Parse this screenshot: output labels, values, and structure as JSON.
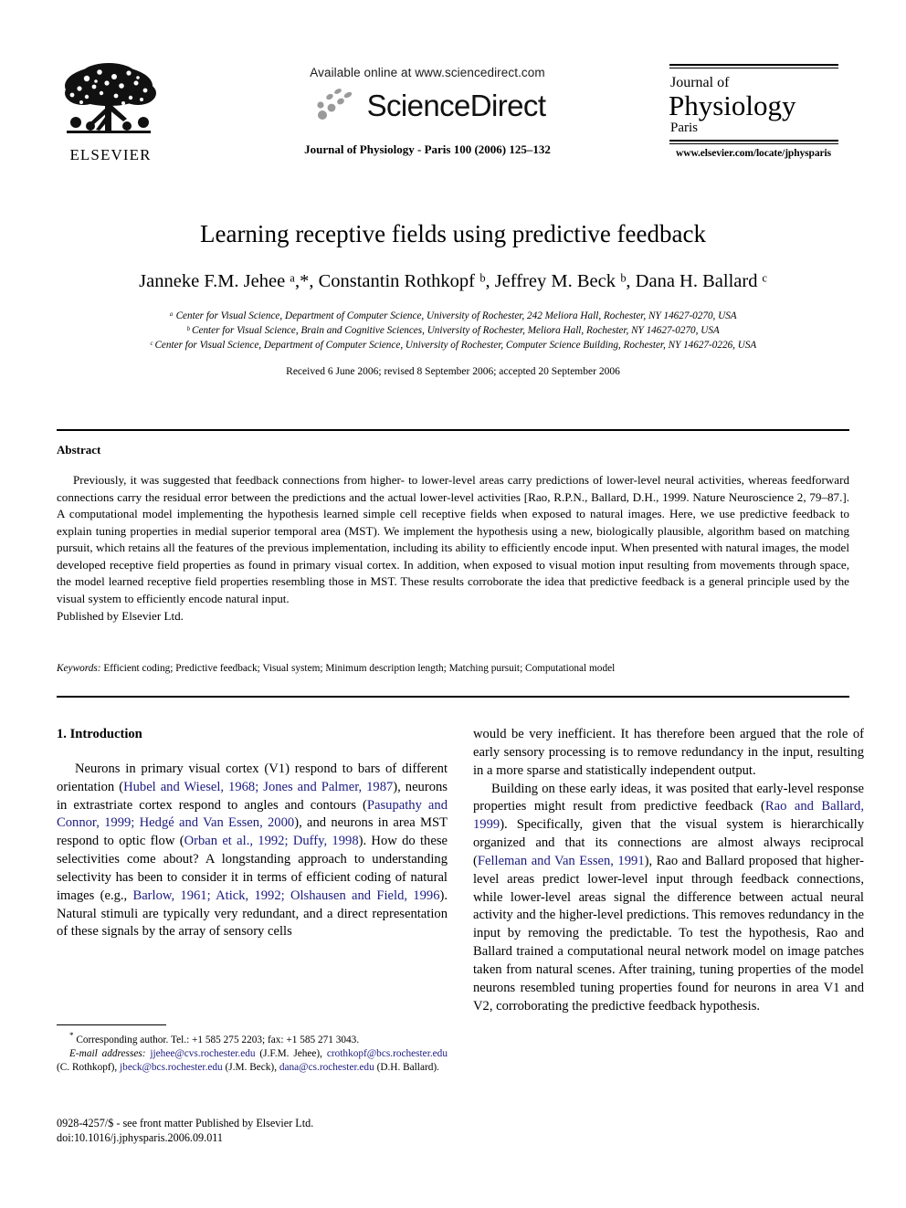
{
  "masthead": {
    "elsevier_wordmark": "ELSEVIER",
    "available_online": "Available online at www.sciencedirect.com",
    "sciencedirect_wordmark": "ScienceDirect",
    "journal_citation": "Journal of Physiology - Paris 100 (2006) 125–132",
    "journal_line1": "Journal of",
    "journal_line2": "Physiology",
    "journal_line3": "Paris",
    "journal_url": "www.elsevier.com/locate/jphysparis"
  },
  "title": "Learning receptive fields using predictive feedback",
  "authors": "Janneke F.M. Jehee ᵃ,*, Constantin Rothkopf ᵇ, Jeffrey M. Beck ᵇ, Dana H. Ballard ᶜ",
  "affiliations": [
    "ᵃ Center for Visual Science, Department of Computer Science, University of Rochester, 242 Meliora Hall, Rochester, NY 14627-0270, USA",
    "ᵇ Center for Visual Science, Brain and Cognitive Sciences, University of Rochester, Meliora Hall, Rochester, NY 14627-0270, USA",
    "ᶜ Center for Visual Science, Department of Computer Science, University of Rochester, Computer Science Building, Rochester, NY 14627-0226, USA"
  ],
  "received_line": "Received 6 June 2006; revised 8 September 2006; accepted 20 September 2006",
  "abstract": {
    "heading": "Abstract",
    "body": "Previously, it was suggested that feedback connections from higher- to lower-level areas carry predictions of lower-level neural activities, whereas feedforward connections carry the residual error between the predictions and the actual lower-level activities [Rao, R.P.N., Ballard, D.H., 1999. Nature Neuroscience 2, 79–87.]. A computational model implementing the hypothesis learned simple cell receptive fields when exposed to natural images. Here, we use predictive feedback to explain tuning properties in medial superior temporal area (MST). We implement the hypothesis using a new, biologically plausible, algorithm based on matching pursuit, which retains all the features of the previous implementation, including its ability to efficiently encode input. When presented with natural images, the model developed receptive field properties as found in primary visual cortex. In addition, when exposed to visual motion input resulting from movements through space, the model learned receptive field properties resembling those in MST. These results corroborate the idea that predictive feedback is a general principle used by the visual system to efficiently encode natural input.",
    "published_by": "Published by Elsevier Ltd."
  },
  "keywords": {
    "label": "Keywords:",
    "value": "Efficient coding; Predictive feedback; Visual system; Minimum description length; Matching pursuit; Computational model"
  },
  "section": {
    "number_title": "1. Introduction"
  },
  "body": {
    "left_para_1_a": "Neurons in primary visual cortex (V1) respond to bars of different orientation (",
    "left_cite_1": "Hubel and Wiesel, 1968; Jones and Palmer, 1987",
    "left_para_1_b": "), neurons in extrastriate cortex respond to angles and contours (",
    "left_cite_2": "Pasupathy and Connor, 1999; Hedgé and Van Essen, 2000",
    "left_para_1_c": "), and neurons in area MST respond to optic flow (",
    "left_cite_3": "Orban et al., 1992; Duffy, 1998",
    "left_para_1_d": "). How do these selectivities come about? A longstanding approach to understanding selectivity has been to consider it in terms of efficient coding of natural images (e.g., ",
    "left_cite_4": "Barlow, 1961; Atick, 1992; Olshausen and Field, 1996",
    "left_para_1_e": "). Natural stimuli are typically very redundant, and a direct representation of these signals by the array of sensory cells",
    "right_para_1": "would be very inefficient. It has therefore been argued that the role of early sensory processing is to remove redundancy in the input, resulting in a more sparse and statistically independent output.",
    "right_para_2_a": "Building on these early ideas, it was posited that early-level response properties might result from predictive feedback (",
    "right_cite_1": "Rao and Ballard, 1999",
    "right_para_2_b": "). Specifically, given that the visual system is hierarchically organized and that its connections are almost always reciprocal (",
    "right_cite_2": "Felleman and Van Essen, 1991",
    "right_para_2_c": "), Rao and Ballard proposed that higher-level areas predict lower-level input through feedback connections, while lower-level areas signal the difference between actual neural activity and the higher-level predictions. This removes redundancy in the input by removing the predictable. To test the hypothesis, Rao and Ballard trained a computational neural network model on image patches taken from natural scenes. After training, tuning properties of the model neurons resembled tuning properties found for neurons in area V1 and V2, corroborating the predictive feedback hypothesis."
  },
  "footnote": {
    "corresponding": "Corresponding author. Tel.: +1 585 275 2203; fax: +1 585 271 3043.",
    "email_label": "E-mail addresses:",
    "email_1": "jjehee@cvs.rochester.edu",
    "email_1_owner": "(J.F.M. Jehee),",
    "email_2": "crothkopf@bcs.rochester.edu",
    "email_2_owner": "(C. Rothkopf),",
    "email_3": "jbeck@bcs.rochester.edu",
    "email_3_owner": "(J.M. Beck),",
    "email_4": "dana@cs.rochester.edu",
    "email_4_owner": "(D.H. Ballard)."
  },
  "colophon": {
    "issn_line": "0928-4257/$ - see front matter Published by Elsevier Ltd.",
    "doi_line": "doi:10.1016/j.jphysparis.2006.09.011"
  },
  "colors": {
    "citation_link": "#1b1b80",
    "text": "#000000",
    "background": "#ffffff"
  }
}
